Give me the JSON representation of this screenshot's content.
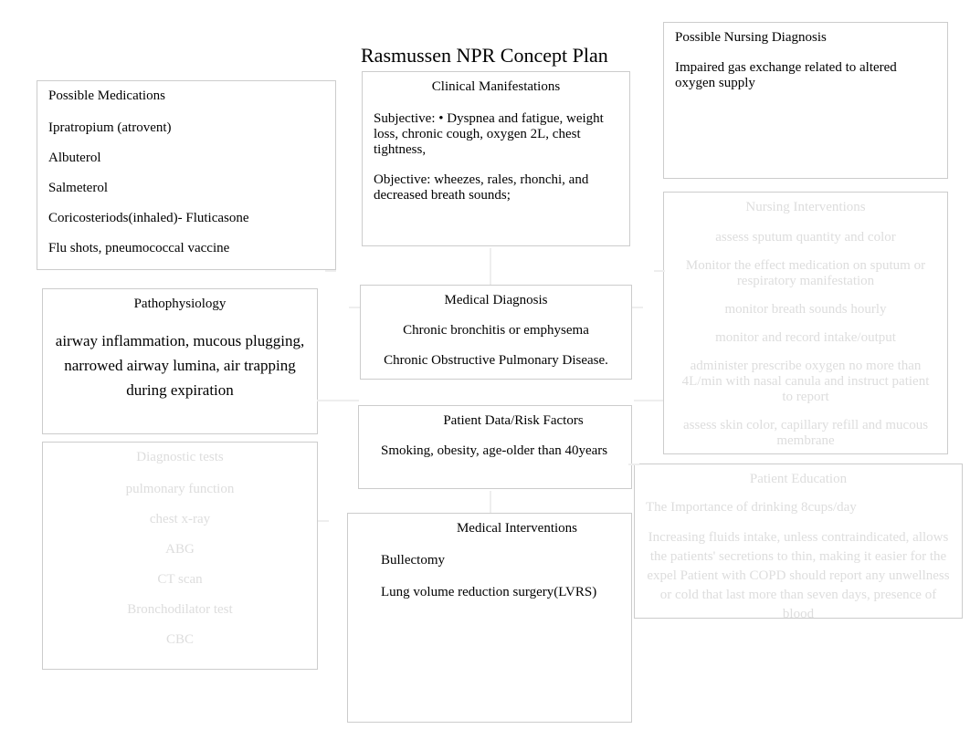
{
  "title": "Rasmussen NPR Concept Plan",
  "medications": {
    "heading": "Possible Medications",
    "items": [
      "Ipratropium (atrovent)",
      "Albuterol",
      "Salmeterol",
      "Coricosteriods(inhaled)- Fluticasone",
      "Flu shots, pneumococcal vaccine"
    ]
  },
  "clinical": {
    "heading": "Clinical Manifestations",
    "subjective": "Subjective: • Dyspnea and fatigue, weight loss, chronic cough, oxygen 2L, chest tightness,",
    "objective": "Objective: wheezes, rales, rhonchi, and decreased breath sounds;"
  },
  "nursing_diagnosis": {
    "heading": "Possible Nursing Diagnosis",
    "text": "Impaired gas exchange related to altered oxygen supply"
  },
  "pathophysiology": {
    "heading": "Pathophysiology",
    "text": "airway inflammation, mucous plugging, narrowed airway lumina, air trapping during expiration"
  },
  "medical_diagnosis": {
    "heading": "Medical Diagnosis",
    "items": [
      "Chronic bronchitis or emphysema",
      "Chronic Obstructive Pulmonary Disease."
    ]
  },
  "risk_factors": {
    "heading": "Patient Data/Risk Factors",
    "text": "Smoking, obesity, age-older than 40years"
  },
  "diagnostic_tests": {
    "heading": "Diagnostic tests",
    "items": [
      "pulmonary function",
      "chest x-ray",
      "ABG",
      "CT scan",
      "Bronchodilator test",
      "CBC"
    ]
  },
  "medical_interventions": {
    "heading": "Medical Interventions",
    "items": [
      "Bullectomy",
      "Lung volume reduction surgery(LVRS)"
    ]
  },
  "nursing_interventions": {
    "heading": "Nursing Interventions",
    "items": [
      "assess sputum quantity and color",
      "Monitor the effect medication on sputum or respiratory manifestation",
      "monitor breath sounds hourly",
      "monitor and record intake/output",
      "administer prescribe oxygen no more than 4L/min with nasal canula and instruct patient to report",
      "assess skin color, capillary refill and mucous membrane"
    ]
  },
  "patient_education": {
    "heading": "Patient Education",
    "item": "The Importance of drinking 8cups/day",
    "text": "Increasing fluids intake, unless contraindicated, allows the patients' secretions to thin, making it easier for the expel Patient with COPD should report any unwellness or cold that last more than seven days, presence of blood"
  }
}
